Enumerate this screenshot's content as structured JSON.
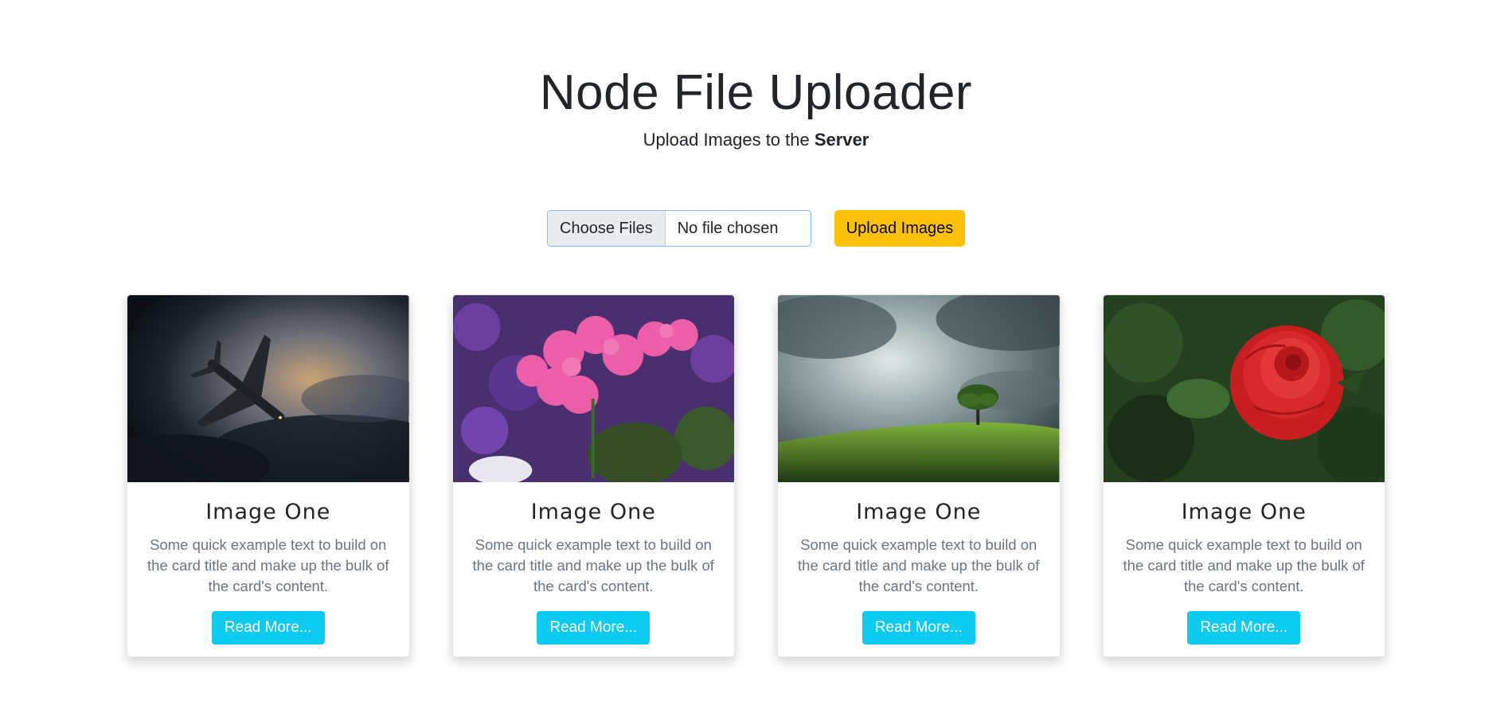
{
  "header": {
    "title": "Node File Uploader",
    "subtitle_prefix": "Upload Images to the ",
    "subtitle_bold": "Server"
  },
  "upload": {
    "choose_label": "Choose Files",
    "file_status": "No file chosen",
    "submit_label": "Upload Images"
  },
  "cards": [
    {
      "title": "Image One",
      "text": "Some quick example text to build on the card title and make up the bulk of the card's content.",
      "button": "Read More...",
      "image": "airplane-in-clouds-image"
    },
    {
      "title": "Image One",
      "text": "Some quick example text to build on the card title and make up the bulk of the card's content.",
      "button": "Read More...",
      "image": "pink-geranium-flowers-image"
    },
    {
      "title": "Image One",
      "text": "Some quick example text to build on the card title and make up the bulk of the card's content.",
      "button": "Read More...",
      "image": "tree-on-hill-storm-image"
    },
    {
      "title": "Image One",
      "text": "Some quick example text to build on the card title and make up the bulk of the card's content.",
      "button": "Read More...",
      "image": "red-rose-image"
    }
  ],
  "colors": {
    "upload_button": "#ffc107",
    "read_more_button": "#0dcaf0",
    "file_input_border": "#86b7fe"
  }
}
